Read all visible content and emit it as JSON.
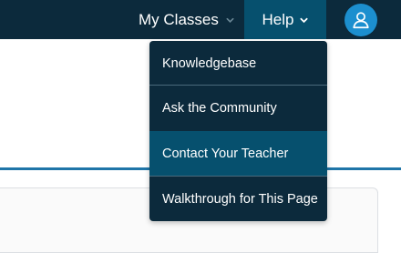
{
  "navbar": {
    "my_classes_label": "My Classes",
    "help_label": "Help",
    "avatar_icon": "user-icon"
  },
  "help_menu": {
    "items": [
      {
        "label": "Knowledgebase",
        "active": false
      },
      {
        "label": "Ask the Community",
        "active": false
      },
      {
        "label": "Contact Your Teacher",
        "active": true
      },
      {
        "label": "Walkthrough for This Page",
        "active": false
      }
    ]
  },
  "colors": {
    "navbar_bg": "#0c2a3c",
    "help_active_bg": "#06506e",
    "avatar_bg": "#1c8fcf",
    "accent_rule": "#1f75a8"
  }
}
